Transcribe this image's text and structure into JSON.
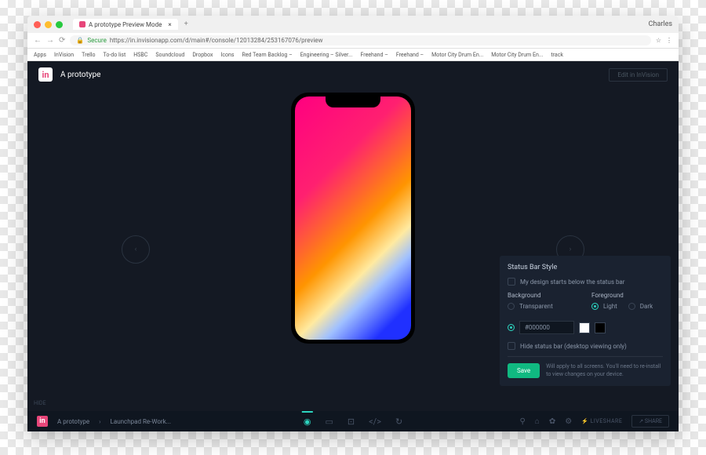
{
  "browser": {
    "tab_title": "A prototype Preview Mode",
    "user": "Charles",
    "url_secure": "Secure",
    "url": "https://in.invisionapp.com/d/main#/console/12013284/253167076/preview",
    "bookmarks": [
      "Apps",
      "InVision",
      "Trello",
      "To-do list",
      "HSBC",
      "Soundcloud",
      "Dropbox",
      "Icons",
      "Red Team Backlog –",
      "Engineering – Silver...",
      "Freehand –",
      "Freehand –",
      "Motor City Drum En...",
      "Motor City Drum En...",
      "track"
    ]
  },
  "app": {
    "title": "A prototype",
    "header_btn": "Edit in InVision",
    "hide": "HIDE",
    "crumb1": "A prototype",
    "crumb2": "Launchpad Re-Work...",
    "live": "LIVESHARE",
    "share": "SHARE"
  },
  "panel": {
    "title": "Status Bar Style",
    "starts_below": "My design starts below the status bar",
    "bg": "Background",
    "fg": "Foreground",
    "transparent": "Transparent",
    "light": "Light",
    "dark": "Dark",
    "color": "#000000",
    "hide_status": "Hide status bar (desktop viewing only)",
    "save": "Save",
    "apply": "Will apply to all screens. You'll need to re-install to view changes on your device."
  }
}
